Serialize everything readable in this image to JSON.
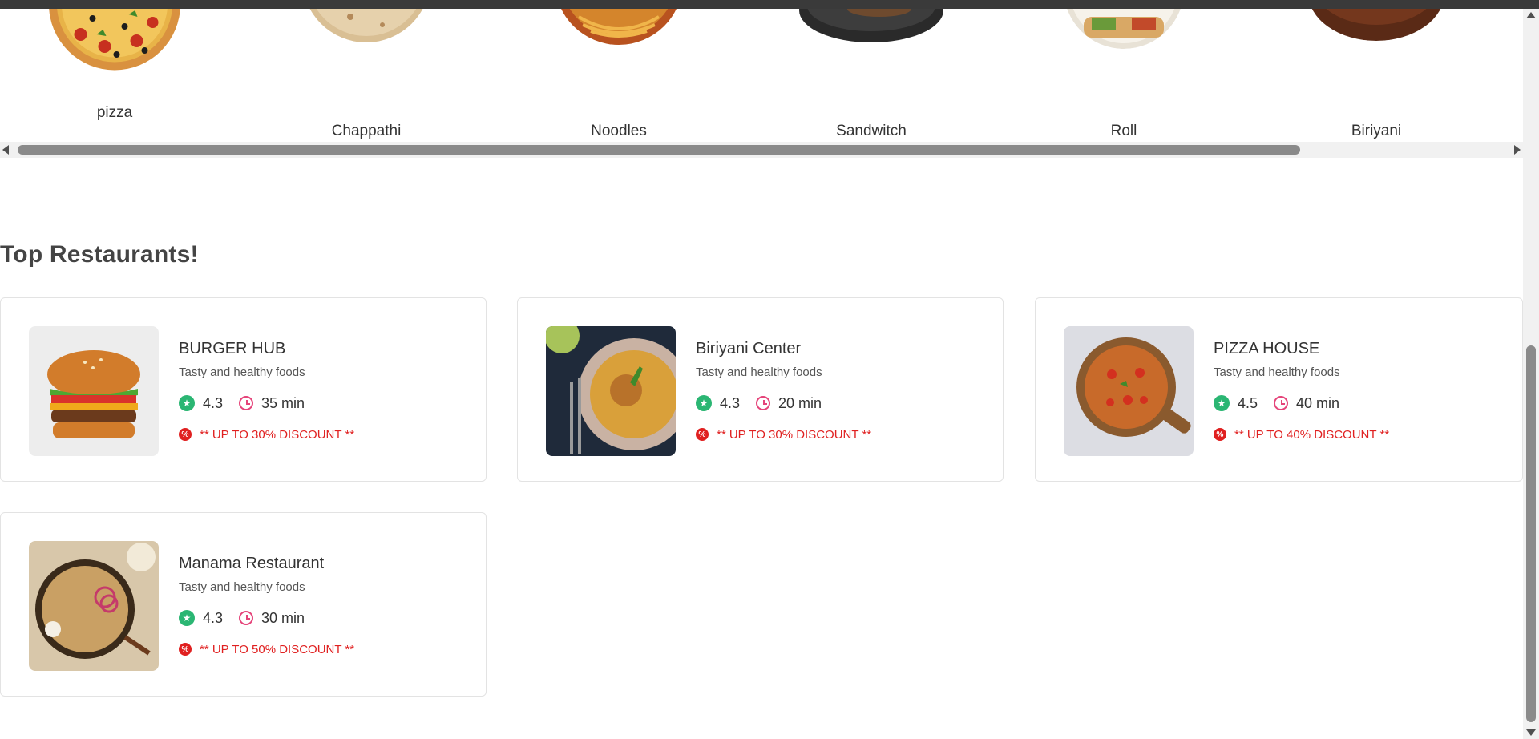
{
  "categories": [
    {
      "label": "pizza",
      "icon": "pizza-image"
    },
    {
      "label": "Chappathi",
      "icon": "chappathi-image"
    },
    {
      "label": "Noodles",
      "icon": "noodles-image"
    },
    {
      "label": "Sandwitch",
      "icon": "sandwich-image"
    },
    {
      "label": "Roll",
      "icon": "roll-image"
    },
    {
      "label": "Biriyani",
      "icon": "biriyani-image"
    }
  ],
  "section_title": "Top Restaurants!",
  "restaurants": [
    {
      "name": "BURGER HUB",
      "tagline": "Tasty and healthy foods",
      "rating": "4.3",
      "time": "35 min",
      "discount": "** UP TO 30% DISCOUNT **",
      "icon": "burger-image"
    },
    {
      "name": "Biriyani Center",
      "tagline": "Tasty and healthy foods",
      "rating": "4.3",
      "time": "20 min",
      "discount": "** UP TO 30% DISCOUNT **",
      "icon": "biriyani-plate-image"
    },
    {
      "name": "PIZZA HOUSE",
      "tagline": "Tasty and healthy foods",
      "rating": "4.5",
      "time": "40 min",
      "discount": "** UP TO 40% DISCOUNT **",
      "icon": "pizza-board-image"
    },
    {
      "name": "Manama Restaurant",
      "tagline": "Tasty and healthy foods",
      "rating": "4.3",
      "time": "30 min",
      "discount": "** UP TO 50% DISCOUNT **",
      "icon": "biriyani-pot-image"
    }
  ],
  "colors": {
    "rating": "#2bb673",
    "clock": "#e5447a",
    "discount": "#e02020",
    "title": "#444444"
  }
}
